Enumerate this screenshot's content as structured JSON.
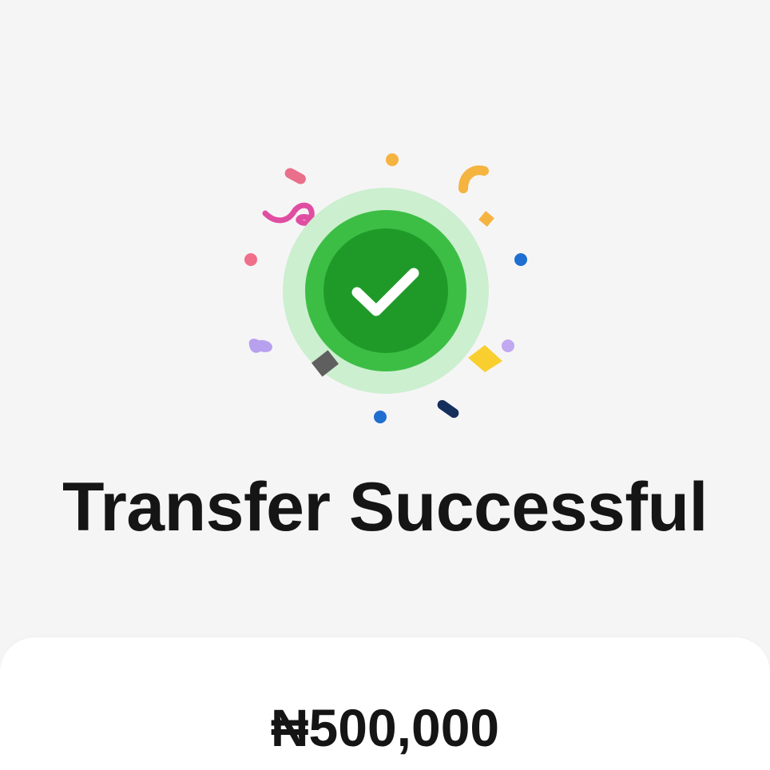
{
  "screen": {
    "title": "Transfer Successful",
    "amount_currency": "₦",
    "amount_value": "500,000"
  },
  "icons": {
    "success": "check-circle-icon",
    "decoration": "confetti"
  },
  "colors": {
    "background": "#f6f5f6",
    "success_outer": "#ccefcf",
    "success_mid": "#3cbe45",
    "success_inner": "#1f9a29",
    "text": "#151515"
  }
}
